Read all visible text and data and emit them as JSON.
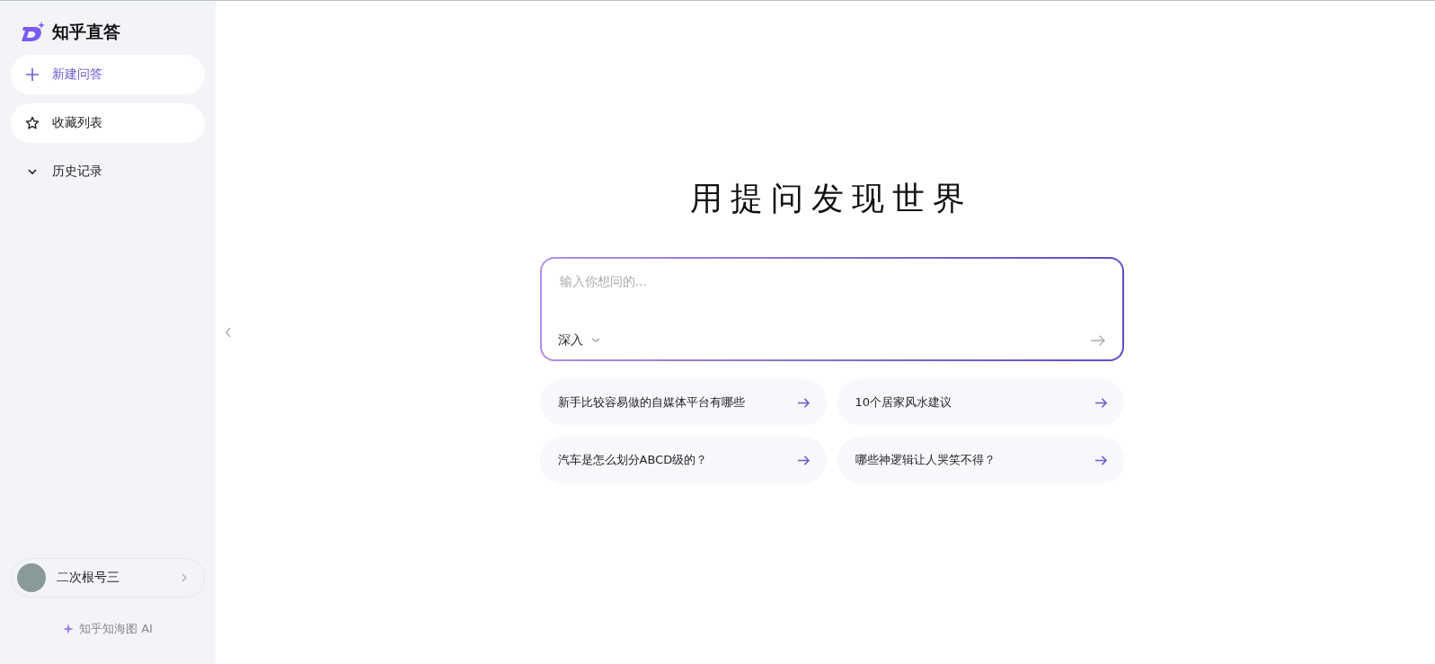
{
  "sidebar": {
    "brand": "知乎直答",
    "items": [
      {
        "kind": "new",
        "label": "新建问答"
      },
      {
        "kind": "favorites",
        "label": "收藏列表"
      },
      {
        "kind": "history",
        "label": "历史记录",
        "expanded": false
      }
    ],
    "user": {
      "name": "二次根号三"
    },
    "footer": "知乎知海图 AI"
  },
  "main": {
    "heading": "用提问发现世界",
    "input": {
      "placeholder": "输入你想问的...",
      "mode": "深入"
    },
    "suggestions": [
      {
        "text": "新手比较容易做的自媒体平台有哪些"
      },
      {
        "text": "10个居家风水建议"
      },
      {
        "text": "汽车是怎么划分ABCD级的？"
      },
      {
        "text": "哪些神逻辑让人哭笑不得？"
      }
    ]
  }
}
